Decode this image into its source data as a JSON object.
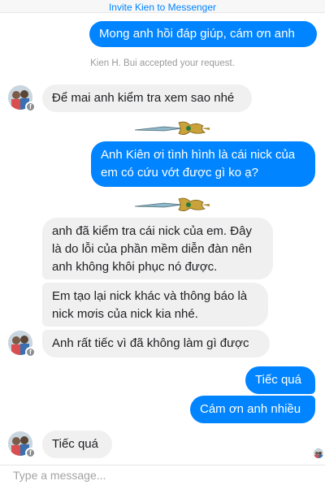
{
  "header": {
    "invite_link": "Invite Kien to Messenger"
  },
  "system": {
    "accepted_notice": "Kien H. Bui accepted your request."
  },
  "messages": {
    "m1": "Mong anh hồi đáp giúp, cám ơn anh",
    "m2": "Để mai anh kiểm tra xem sao nhé",
    "m3_l1": "Anh Kiên ơi tình hình là cái nick của",
    "m3_l2": "em có cứu vớt được gì ko ạ?",
    "m4_l1": "anh đã kiểm tra cái nick của em. Đây",
    "m4_l2": "là do lỗi của phần mềm diễn đàn nên",
    "m4_l3": "anh không khôi phục nó được.",
    "m5_l1": "Em tạo lại nick khác và thông báo là",
    "m5_l2": "nick mơis của nick kia nhé.",
    "m6": "Anh rất tiếc vì đã không làm gì được",
    "m7": "Tiếc quá",
    "m8": "Cám ơn anh nhiều",
    "m9": "Tiếc quá"
  },
  "composer": {
    "placeholder": "Type a message..."
  },
  "icons": {
    "avatar_badge": "messenger-platform-badge-icon",
    "sticker": "golden-dragon-sword-sticker"
  },
  "colors": {
    "accent": "#0084ff",
    "incoming_bubble": "#f1f0f0",
    "system_text": "#9a9a9a"
  }
}
